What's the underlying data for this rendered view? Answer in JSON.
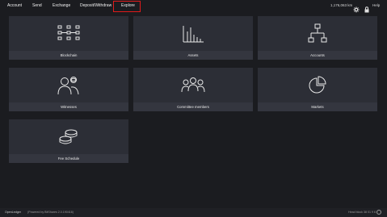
{
  "nav": {
    "items": [
      {
        "label": "Account"
      },
      {
        "label": "Send"
      },
      {
        "label": "Exchange"
      },
      {
        "label": "Deposit/Withdraw"
      },
      {
        "label": "Explore"
      }
    ],
    "active": "Explore"
  },
  "topbar": {
    "balance": "1,176,063 km",
    "help_label": "Help",
    "icons": [
      "gear-icon",
      "lock-icon"
    ]
  },
  "tiles": [
    {
      "label": "Blockchain",
      "icon": "blockchain-icon"
    },
    {
      "label": "Assets",
      "icon": "bar-chart-icon"
    },
    {
      "label": "Accounts",
      "icon": "org-chart-icon"
    },
    {
      "label": "Witnesses",
      "icon": "witness-icon"
    },
    {
      "label": "Committee members",
      "icon": "group-icon"
    },
    {
      "label": "Markets",
      "icon": "pie-chart-icon"
    },
    {
      "label": "Fee Schedule",
      "icon": "coins-icon"
    }
  ],
  "footer": {
    "brand": "OpenLedger",
    "powered": "(Powered by BitShares 2.0.190416)",
    "head_block": "Head block 38 01 9 6"
  },
  "colors": {
    "background": "#1b1c20",
    "tile": "#2c2e36",
    "tile_label_bg": "#34363f",
    "highlight": "#e01b1b"
  }
}
